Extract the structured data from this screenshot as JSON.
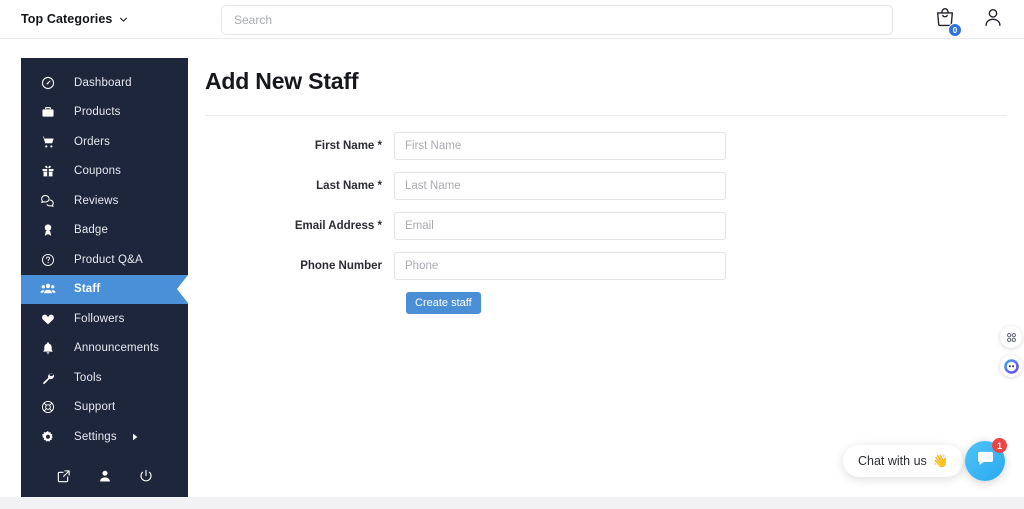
{
  "header": {
    "categories_label": "Top Categories",
    "categories_icon": "chevron-down-icon",
    "search": {
      "placeholder": "Search",
      "value": ""
    },
    "cart": {
      "icon": "shopping-bag-icon",
      "badge": "0"
    },
    "account": {
      "icon": "user-icon"
    }
  },
  "sidebar": {
    "items": [
      {
        "label": "Dashboard",
        "icon": "speedometer-icon",
        "active": false
      },
      {
        "label": "Products",
        "icon": "briefcase-icon",
        "active": false
      },
      {
        "label": "Orders",
        "icon": "shopping-cart-icon",
        "active": false
      },
      {
        "label": "Coupons",
        "icon": "gift-icon",
        "active": false
      },
      {
        "label": "Reviews",
        "icon": "chat-bubbles-icon",
        "active": false
      },
      {
        "label": "Badge",
        "icon": "award-icon",
        "active": false
      },
      {
        "label": "Product Q&A",
        "icon": "question-circle-icon",
        "active": false
      },
      {
        "label": "Staff",
        "icon": "users-icon",
        "active": true
      },
      {
        "label": "Followers",
        "icon": "heart-icon",
        "active": false
      },
      {
        "label": "Announcements",
        "icon": "bell-icon",
        "active": false
      },
      {
        "label": "Tools",
        "icon": "wrench-icon",
        "active": false
      },
      {
        "label": "Support",
        "icon": "lifebuoy-icon",
        "active": false
      },
      {
        "label": "Settings",
        "icon": "gear-icon",
        "active": false,
        "submenu_icon": "caret-right-icon"
      }
    ],
    "footer_icons": [
      {
        "name": "external-link-icon"
      },
      {
        "name": "user-icon"
      },
      {
        "name": "power-icon"
      }
    ],
    "active_color": "#4a90d9",
    "background_color": "#1e263c"
  },
  "main": {
    "title": "Add New Staff",
    "form": {
      "fields": [
        {
          "label": "First Name *",
          "placeholder": "First Name",
          "value": ""
        },
        {
          "label": "Last Name *",
          "placeholder": "Last Name",
          "value": ""
        },
        {
          "label": "Email Address *",
          "placeholder": "Email",
          "value": ""
        },
        {
          "label": "Phone Number",
          "placeholder": "Phone",
          "value": ""
        }
      ],
      "submit_label": "Create staff",
      "submit_color": "#4a8ed6"
    }
  },
  "float_widgets": [
    {
      "icon": "grid-apps-icon"
    },
    {
      "icon": "face-circle-icon"
    }
  ],
  "chat": {
    "prompt": "Chat with us",
    "emoji": "👋",
    "launcher_icon": "chat-message-icon",
    "badge": "1",
    "badge_color": "#ef4444"
  }
}
